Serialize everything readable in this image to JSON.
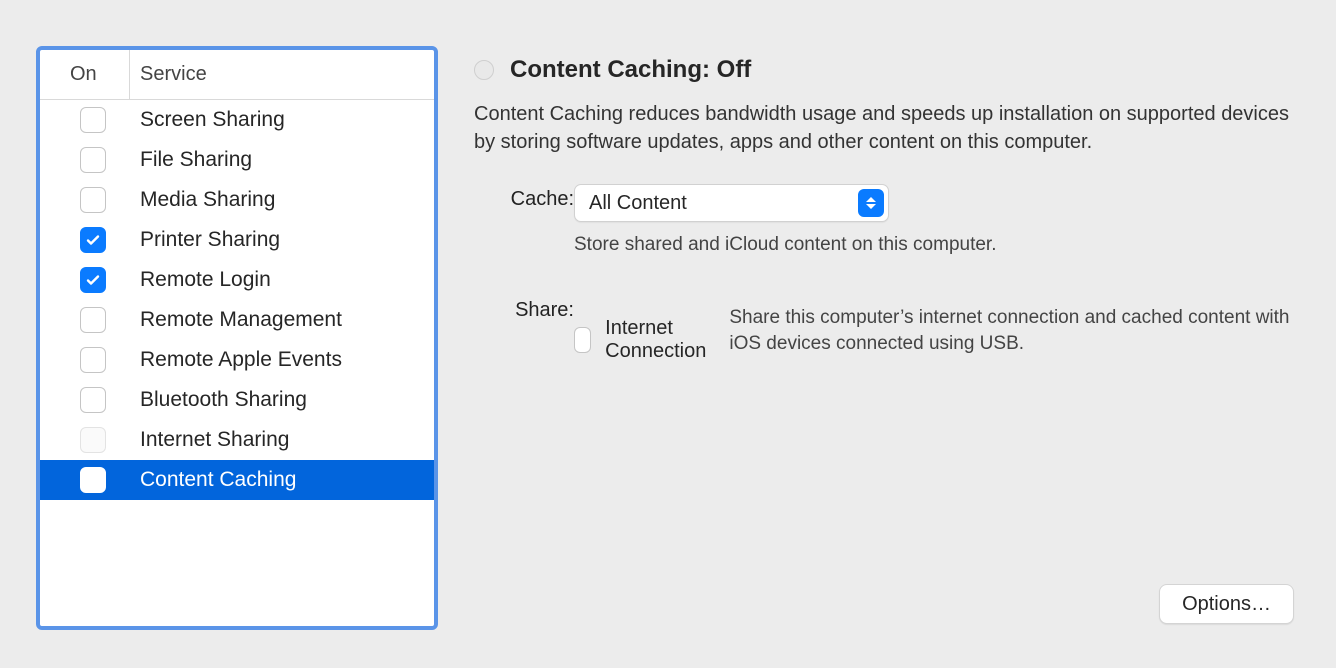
{
  "sidebar": {
    "header_on": "On",
    "header_service": "Service",
    "items": [
      {
        "label": "Screen Sharing",
        "state": "unchecked",
        "selected": false
      },
      {
        "label": "File Sharing",
        "state": "unchecked",
        "selected": false
      },
      {
        "label": "Media Sharing",
        "state": "unchecked",
        "selected": false
      },
      {
        "label": "Printer Sharing",
        "state": "checked",
        "selected": false
      },
      {
        "label": "Remote Login",
        "state": "checked",
        "selected": false
      },
      {
        "label": "Remote Management",
        "state": "unchecked",
        "selected": false
      },
      {
        "label": "Remote Apple Events",
        "state": "unchecked",
        "selected": false
      },
      {
        "label": "Bluetooth Sharing",
        "state": "unchecked",
        "selected": false
      },
      {
        "label": "Internet Sharing",
        "state": "disabled",
        "selected": false
      },
      {
        "label": "Content Caching",
        "state": "unchecked",
        "selected": true
      }
    ]
  },
  "detail": {
    "title": "Content Caching: Off",
    "description": "Content Caching reduces bandwidth usage and speeds up installation on supported devices by storing software updates, apps and other content on this computer.",
    "cache_label": "Cache:",
    "cache_value": "All Content",
    "cache_hint": "Store shared and iCloud content on this computer.",
    "share_label": "Share:",
    "share_option": "Internet Connection",
    "share_hint": "Share this computer’s internet connection and cached content with iOS devices connected using USB."
  },
  "options_button": "Options…"
}
